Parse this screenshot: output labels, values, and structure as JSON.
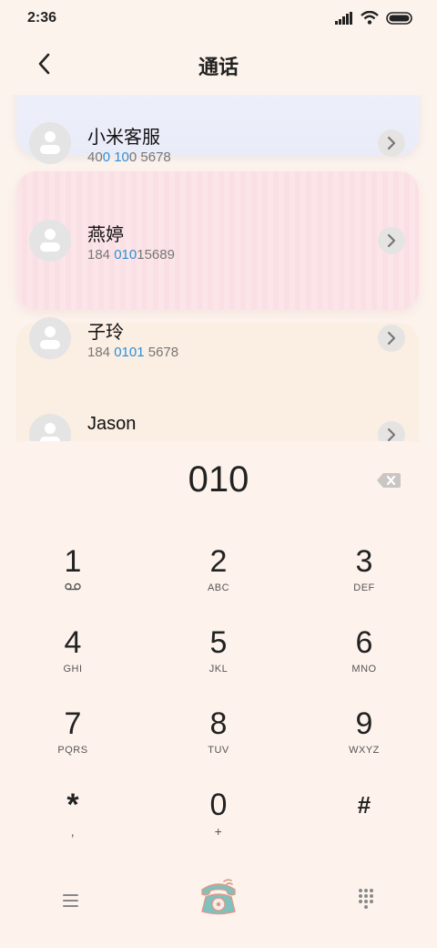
{
  "status_bar": {
    "time": "2:36"
  },
  "header": {
    "title": "通话"
  },
  "contacts": [
    {
      "name": "小米客服",
      "number_parts": [
        "40",
        "0 10",
        "0 5678"
      ]
    },
    {
      "name": "燕婷",
      "number_parts": [
        "184 ",
        "010",
        "15689"
      ]
    },
    {
      "name": "子玲",
      "number_parts": [
        "184 ",
        "0101",
        " 5678"
      ]
    },
    {
      "name": "Jason",
      "number_parts": [
        "",
        "",
        ""
      ]
    }
  ],
  "dialer": {
    "input": "010",
    "keys": [
      {
        "digit": "1",
        "sub": ""
      },
      {
        "digit": "2",
        "sub": "ABC"
      },
      {
        "digit": "3",
        "sub": "DEF"
      },
      {
        "digit": "4",
        "sub": "GHI"
      },
      {
        "digit": "5",
        "sub": "JKL"
      },
      {
        "digit": "6",
        "sub": "MNO"
      },
      {
        "digit": "7",
        "sub": "PQRS"
      },
      {
        "digit": "8",
        "sub": "TUV"
      },
      {
        "digit": "9",
        "sub": "WXYZ"
      },
      {
        "digit": "*",
        "sub": ","
      },
      {
        "digit": "0",
        "sub": "+"
      },
      {
        "digit": "#",
        "sub": ""
      }
    ]
  },
  "icons": {
    "back": "chevron-left-icon",
    "backspace": "backspace-icon",
    "menu": "hamburger-menu-icon",
    "call": "rotary-phone-icon",
    "keypad": "dialpad-icon",
    "voicemail": "voicemail-icon"
  },
  "colors": {
    "background": "#fcf3ec",
    "highlight": "#2f8fd6",
    "call_button": "#6fb7b2"
  }
}
